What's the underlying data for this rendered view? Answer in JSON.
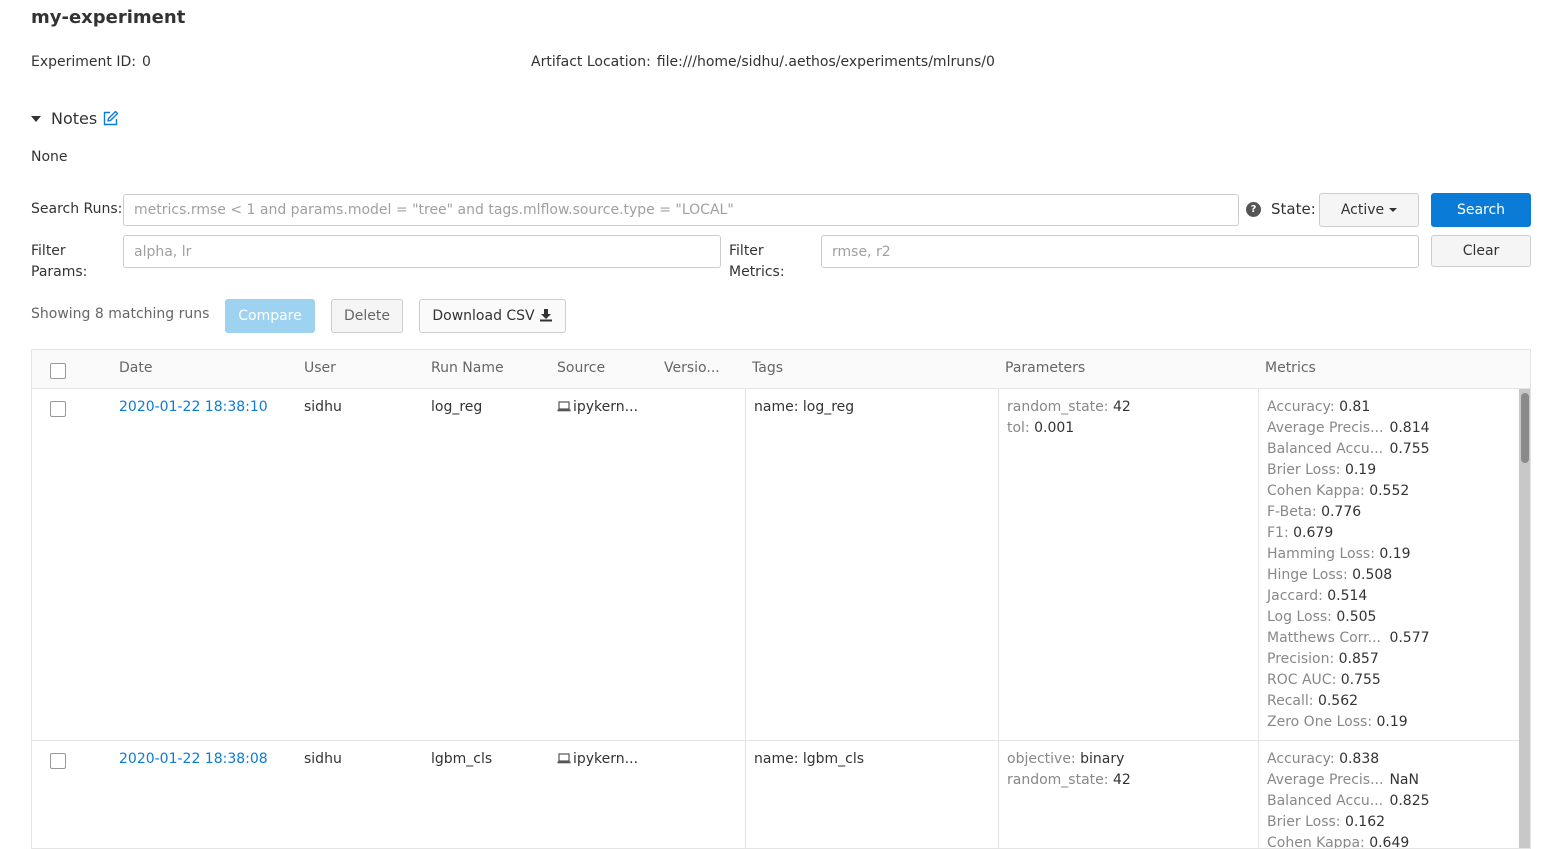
{
  "experiment": {
    "name": "my-experiment",
    "id_label": "Experiment ID:",
    "id_value": "0",
    "artifact_label": "Artifact Location:",
    "artifact_value": "file:///home/sidhu/.aethos/experiments/mlruns/0"
  },
  "notes": {
    "title": "Notes",
    "body": "None"
  },
  "search": {
    "label": "Search Runs:",
    "placeholder": "metrics.rmse < 1 and params.model = \"tree\" and tags.mlflow.source.type = \"LOCAL\"",
    "help_icon": "?",
    "state_label": "State:",
    "state_value": "Active",
    "search_button": "Search",
    "filter_params_label_1": "Filter",
    "filter_params_label_2": "Params:",
    "filter_params_placeholder": "alpha, lr",
    "filter_metrics_label_1": "Filter",
    "filter_metrics_label_2": "Metrics:",
    "filter_metrics_placeholder": "rmse, r2",
    "clear_button": "Clear"
  },
  "toolbar": {
    "showing": "Showing 8 matching runs",
    "compare": "Compare",
    "delete": "Delete",
    "download_csv": "Download CSV"
  },
  "table": {
    "headers": [
      "Date",
      "User",
      "Run Name",
      "Source",
      "Versio...",
      "Tags",
      "Parameters",
      "Metrics"
    ],
    "rows": [
      {
        "date": "2020-01-22 18:38:10",
        "user": "sidhu",
        "run_name": "log_reg",
        "source": "ipykern...",
        "version": "",
        "tags": [
          {
            "k": "name:",
            "v": "log_reg"
          }
        ],
        "params": [
          {
            "k": "random_state:",
            "v": "42"
          },
          {
            "k": "tol:",
            "v": "0.001"
          }
        ],
        "metrics": [
          {
            "k": "Accuracy:",
            "v": "0.81",
            "trunc": false
          },
          {
            "k": "Average Precis...",
            "v": "0.814",
            "trunc": true
          },
          {
            "k": "Balanced Accu...",
            "v": "0.755",
            "trunc": true
          },
          {
            "k": "Brier Loss:",
            "v": "0.19",
            "trunc": false
          },
          {
            "k": "Cohen Kappa:",
            "v": "0.552",
            "trunc": false
          },
          {
            "k": "F-Beta:",
            "v": "0.776",
            "trunc": false
          },
          {
            "k": "F1:",
            "v": "0.679",
            "trunc": false
          },
          {
            "k": "Hamming Loss:",
            "v": "0.19",
            "trunc": false
          },
          {
            "k": "Hinge Loss:",
            "v": "0.508",
            "trunc": false
          },
          {
            "k": "Jaccard:",
            "v": "0.514",
            "trunc": false
          },
          {
            "k": "Log Loss:",
            "v": "0.505",
            "trunc": false
          },
          {
            "k": "Matthews Corr...",
            "v": "0.577",
            "trunc": true
          },
          {
            "k": "Precision:",
            "v": "0.857",
            "trunc": false
          },
          {
            "k": "ROC AUC:",
            "v": "0.755",
            "trunc": false
          },
          {
            "k": "Recall:",
            "v": "0.562",
            "trunc": false
          },
          {
            "k": "Zero One Loss:",
            "v": "0.19",
            "trunc": false
          }
        ]
      },
      {
        "date": "2020-01-22 18:38:08",
        "user": "sidhu",
        "run_name": "lgbm_cls",
        "source": "ipykern...",
        "version": "",
        "tags": [
          {
            "k": "name:",
            "v": "lgbm_cls"
          }
        ],
        "params": [
          {
            "k": "objective:",
            "v": "binary"
          },
          {
            "k": "random_state:",
            "v": "42"
          }
        ],
        "metrics": [
          {
            "k": "Accuracy:",
            "v": "0.838",
            "trunc": false
          },
          {
            "k": "Average Precis...",
            "v": "NaN",
            "trunc": true
          },
          {
            "k": "Balanced Accu...",
            "v": "0.825",
            "trunc": true
          },
          {
            "k": "Brier Loss:",
            "v": "0.162",
            "trunc": false
          },
          {
            "k": "Cohen Kappa:",
            "v": "0.649",
            "trunc": false
          }
        ]
      }
    ]
  },
  "colors": {
    "primary": "#0a7bd6",
    "compare_disabled": "#9dd2f0",
    "link": "#0a7bd6"
  },
  "icons": {
    "notes_edit": "edit-icon",
    "help": "help-icon",
    "download": "download-icon",
    "source": "laptop-icon"
  }
}
